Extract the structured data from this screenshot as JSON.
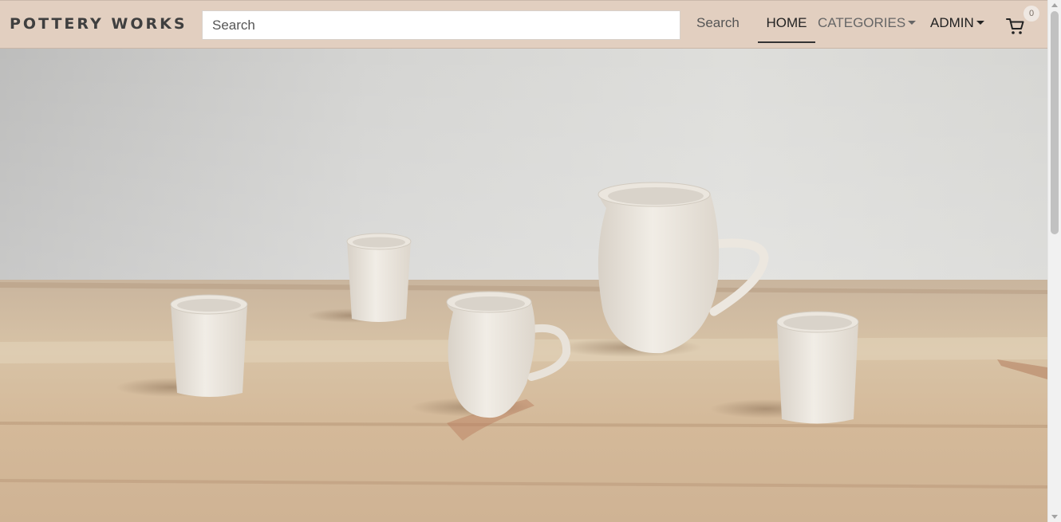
{
  "brand": {
    "name": "POTTERY WORKS"
  },
  "search": {
    "placeholder": "Search",
    "button_label": "Search"
  },
  "nav": {
    "home": "HOME",
    "categories": "CATEGORIES",
    "admin": "ADMIN",
    "active": "HOME"
  },
  "cart": {
    "icon": "cart-icon",
    "count": "0"
  },
  "hero": {
    "image": "photo-of-white-ceramic-cups-and-pitchers-on-wooden-table"
  },
  "colors": {
    "navbar_bg": "#e2cfc0",
    "brand_text": "#3f3f3f",
    "active_underline": "#333333"
  }
}
